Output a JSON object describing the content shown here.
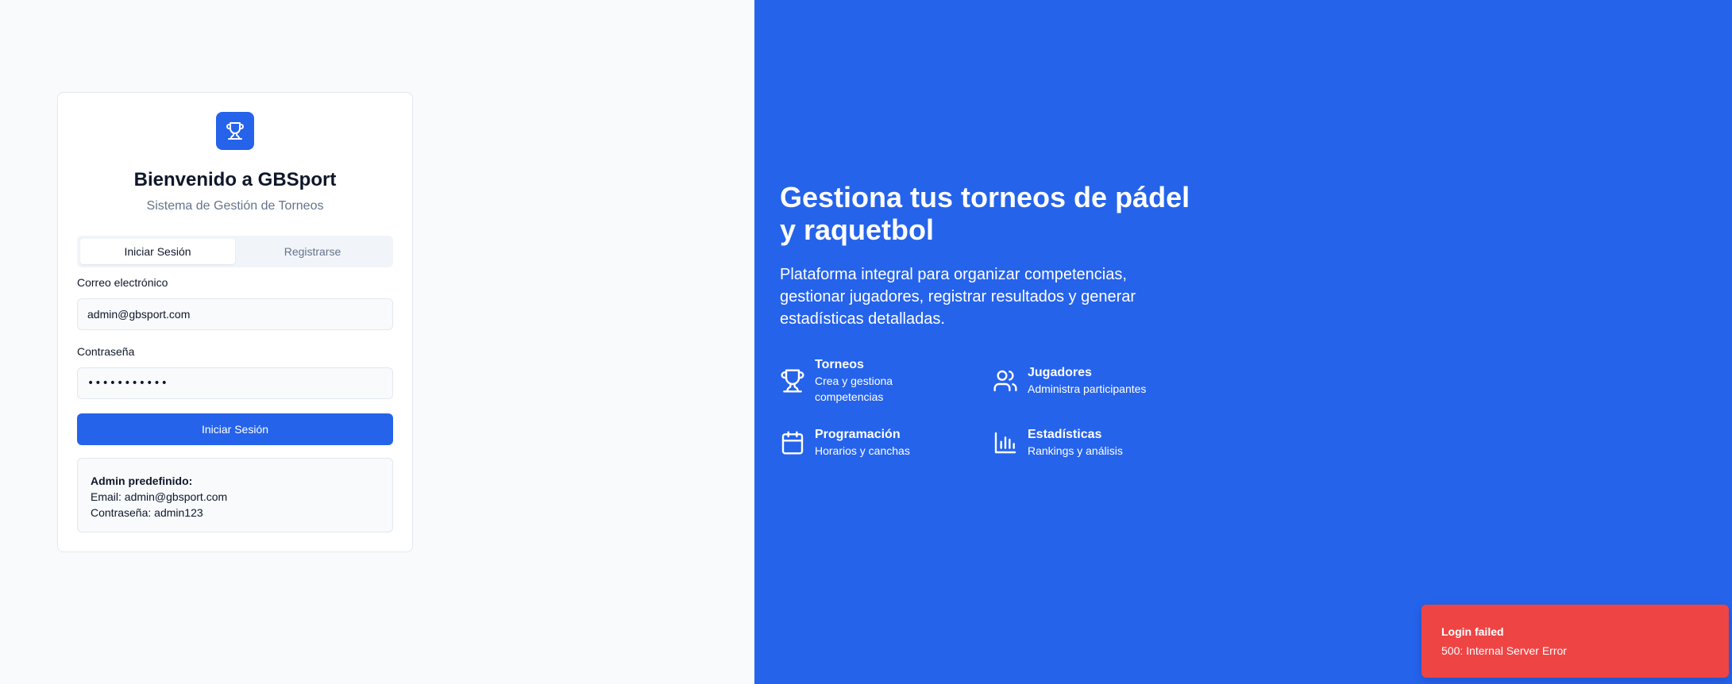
{
  "colors": {
    "primary": "#2563eb",
    "background": "#f8fafc",
    "error": "#ef4444"
  },
  "login_card": {
    "logo_icon": "trophy-icon",
    "title": "Bienvenido a GBSport",
    "subtitle": "Sistema de Gestión de Torneos",
    "tabs": [
      {
        "label": "Iniciar Sesión",
        "active": true
      },
      {
        "label": "Registrarse",
        "active": false
      }
    ],
    "email": {
      "label": "Correo electrónico",
      "value": "admin@gbsport.com"
    },
    "password": {
      "label": "Contraseña",
      "masked_value": "•••••••••••"
    },
    "submit_label": "Iniciar Sesión",
    "default_admin": {
      "title": "Admin predefinido:",
      "email_line": "Email: admin@gbsport.com",
      "password_line": "Contraseña: admin123"
    }
  },
  "hero": {
    "title": "Gestiona tus torneos de pádel y raquetbol",
    "description": "Plataforma integral para organizar competencias, gestionar jugadores, registrar resultados y generar estadísticas detalladas.",
    "features": [
      {
        "icon": "trophy-icon",
        "title": "Torneos",
        "description": "Crea y gestiona competencias"
      },
      {
        "icon": "users-icon",
        "title": "Jugadores",
        "description": "Administra participantes"
      },
      {
        "icon": "calendar-icon",
        "title": "Programación",
        "description": "Horarios y canchas"
      },
      {
        "icon": "bar-chart-icon",
        "title": "Estadísticas",
        "description": "Rankings y análisis"
      }
    ]
  },
  "toast": {
    "title": "Login failed",
    "message": "500: Internal Server Error"
  }
}
